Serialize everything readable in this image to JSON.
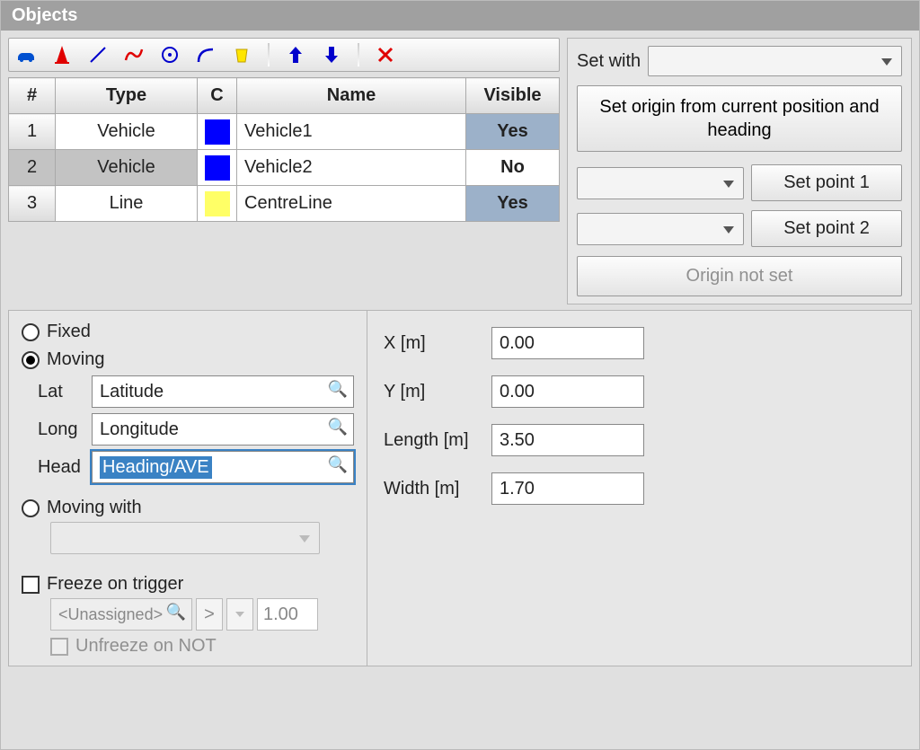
{
  "title": "Objects",
  "columns": {
    "num": "#",
    "type": "Type",
    "c": "C",
    "name": "Name",
    "visible": "Visible"
  },
  "rows": [
    {
      "num": "1",
      "type": "Vehicle",
      "color": "#0000ff",
      "name": "Vehicle1",
      "visible": "Yes",
      "vis_cls": "visible-yes",
      "sel": false
    },
    {
      "num": "2",
      "type": "Vehicle",
      "color": "#0000ff",
      "name": "Vehicle2",
      "visible": "No",
      "vis_cls": "visible-no",
      "sel": true
    },
    {
      "num": "3",
      "type": "Line",
      "color": "#ffff66",
      "name": "CentreLine",
      "visible": "Yes",
      "vis_cls": "visible-yes",
      "sel": false
    }
  ],
  "right": {
    "set_with": "Set with",
    "origin_btn": "Set origin from current position and heading",
    "set_point1": "Set point 1",
    "set_point2": "Set point 2",
    "origin_status": "Origin not set"
  },
  "detail": {
    "fixed": "Fixed",
    "moving": "Moving",
    "lat_label": "Lat",
    "lat_value": "Latitude",
    "long_label": "Long",
    "long_value": "Longitude",
    "head_label": "Head",
    "head_value": "Heading/AVE",
    "moving_with": "Moving with",
    "freeze": "Freeze on trigger",
    "freeze_channel": "<Unassigned>",
    "freeze_op": ">",
    "freeze_val": "1.00",
    "unfreeze": "Unfreeze on NOT"
  },
  "dims": {
    "x_label": "X [m]",
    "x_value": "0.00",
    "y_label": "Y [m]",
    "y_value": "0.00",
    "len_label": "Length [m]",
    "len_value": "3.50",
    "wid_label": "Width [m]",
    "wid_value": "1.70"
  }
}
